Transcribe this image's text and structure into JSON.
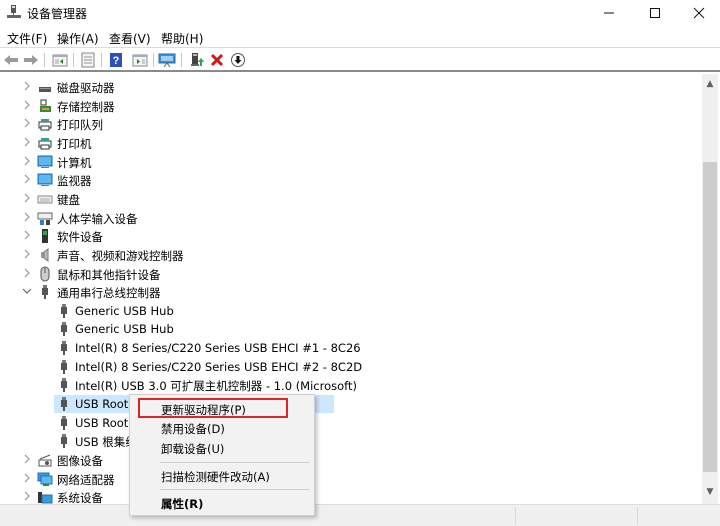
{
  "window": {
    "title": "设备管理器",
    "controls": {
      "minimize": "minimize",
      "maximize": "maximize",
      "close": "close"
    }
  },
  "menubar": {
    "items": [
      {
        "label": "文件(F)"
      },
      {
        "label": "操作(A)"
      },
      {
        "label": "查看(V)"
      },
      {
        "label": "帮助(H)"
      }
    ]
  },
  "toolbar": {
    "buttons": [
      {
        "icon": "back-arrow-icon"
      },
      {
        "icon": "forward-arrow-icon"
      },
      {
        "icon": "show-hide-console-tree-icon"
      },
      {
        "icon": "properties-icon"
      },
      {
        "icon": "help-icon"
      },
      {
        "icon": "show-action-pane-icon"
      },
      {
        "icon": "scan-hardware-icon"
      },
      {
        "icon": "update-driver-icon"
      },
      {
        "icon": "uninstall-device-icon"
      },
      {
        "icon": "disable-device-icon"
      }
    ]
  },
  "tree": {
    "items": [
      {
        "label": "磁盘驱动器",
        "icon": "disk-drive-icon",
        "level": 0,
        "expanded": false
      },
      {
        "label": "存储控制器",
        "icon": "storage-controller-icon",
        "level": 0,
        "expanded": false
      },
      {
        "label": "打印队列",
        "icon": "print-queue-icon",
        "level": 0,
        "expanded": false
      },
      {
        "label": "打印机",
        "icon": "printer-icon",
        "level": 0,
        "expanded": false
      },
      {
        "label": "计算机",
        "icon": "computer-icon",
        "level": 0,
        "expanded": false
      },
      {
        "label": "监视器",
        "icon": "monitor-icon",
        "level": 0,
        "expanded": false
      },
      {
        "label": "键盘",
        "icon": "keyboard-icon",
        "level": 0,
        "expanded": false
      },
      {
        "label": "人体学输入设备",
        "icon": "hid-icon",
        "level": 0,
        "expanded": false
      },
      {
        "label": "软件设备",
        "icon": "software-device-icon",
        "level": 0,
        "expanded": false
      },
      {
        "label": "声音、视频和游戏控制器",
        "icon": "speaker-icon",
        "level": 0,
        "expanded": false
      },
      {
        "label": "鼠标和其他指针设备",
        "icon": "mouse-icon",
        "level": 0,
        "expanded": false
      },
      {
        "label": "通用串行总线控制器",
        "icon": "usb-icon",
        "level": 0,
        "expanded": true
      },
      {
        "label": "Generic USB Hub",
        "icon": "usb-icon",
        "level": 1
      },
      {
        "label": "Generic USB Hub",
        "icon": "usb-icon",
        "level": 1
      },
      {
        "label": "Intel(R) 8 Series/C220 Series USB EHCI #1 - 8C26",
        "icon": "usb-icon",
        "level": 1
      },
      {
        "label": "Intel(R) 8 Series/C220 Series USB EHCI #2 - 8C2D",
        "icon": "usb-icon",
        "level": 1
      },
      {
        "label": "Intel(R) USB 3.0 可扩展主机控制器 - 1.0 (Microsoft)",
        "icon": "usb-icon",
        "level": 1
      },
      {
        "label": "USB Root",
        "icon": "usb-icon",
        "level": 1,
        "selected": true
      },
      {
        "label": "USB Root",
        "icon": "usb-icon",
        "level": 1
      },
      {
        "label": "USB 根集线",
        "icon": "usb-icon",
        "level": 1
      },
      {
        "label": "图像设备",
        "icon": "imaging-device-icon",
        "level": 0,
        "expanded": false
      },
      {
        "label": "网络适配器",
        "icon": "network-adapter-icon",
        "level": 0,
        "expanded": false
      },
      {
        "label": "系统设备",
        "icon": "system-device-icon",
        "level": 0,
        "expanded": false
      }
    ]
  },
  "context_menu": {
    "items": [
      {
        "label": "更新驱动程序(P)",
        "highlighted": true
      },
      {
        "label": "禁用设备(D)"
      },
      {
        "label": "卸载设备(U)"
      },
      {
        "separator": true
      },
      {
        "label": "扫描检测硬件改动(A)"
      },
      {
        "separator": true
      },
      {
        "label": "属性(R)",
        "bold": true
      }
    ]
  },
  "colors": {
    "selection": "#cce8ff",
    "highlight_box": "#e02424"
  }
}
